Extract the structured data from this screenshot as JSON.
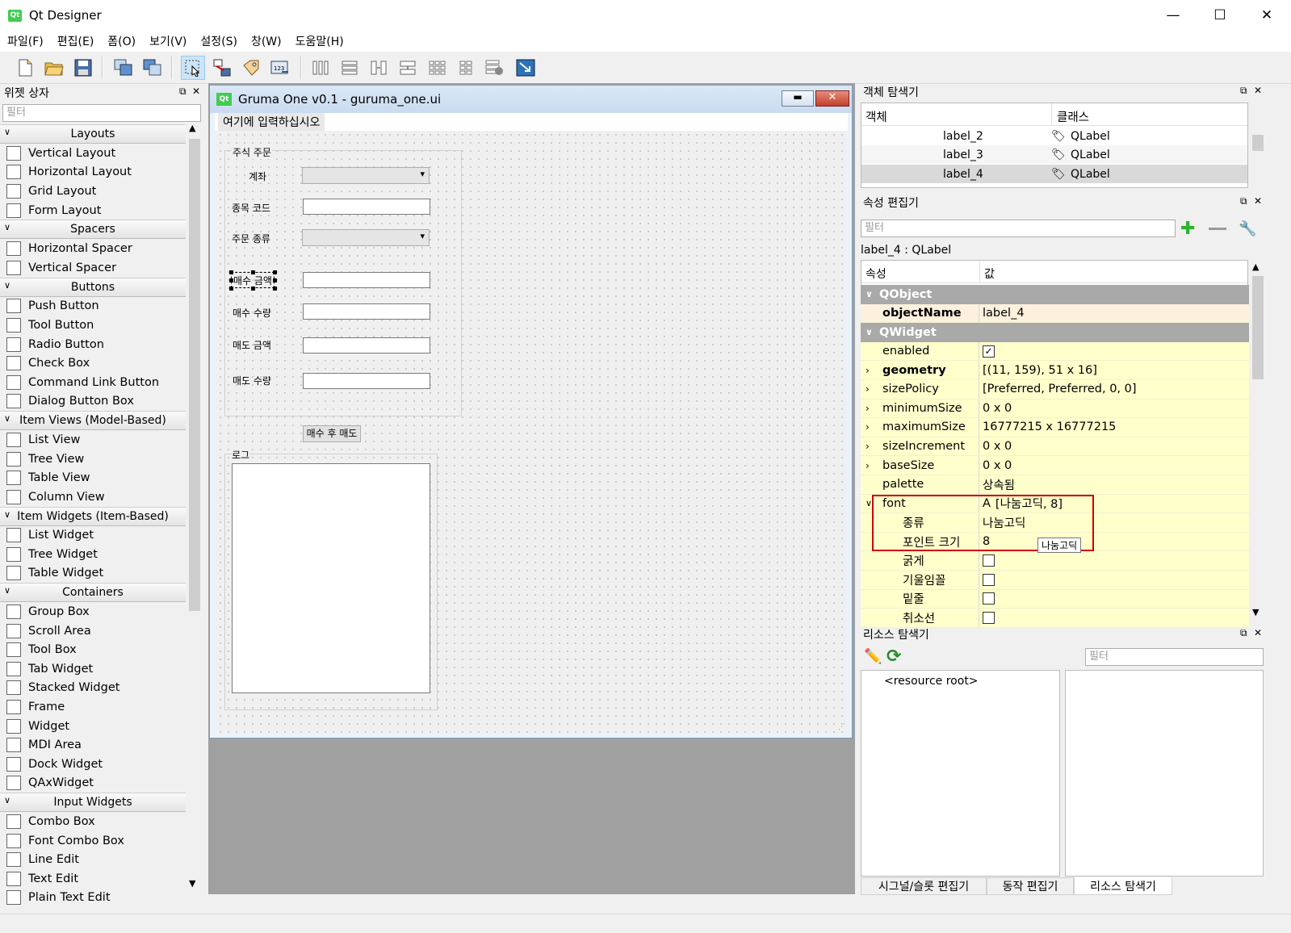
{
  "window": {
    "title": "Qt Designer",
    "minimize": "—",
    "maximize": "☐",
    "close": "✕"
  },
  "menu": [
    "파일(F)",
    "편집(E)",
    "폼(O)",
    "보기(V)",
    "설정(S)",
    "창(W)",
    "도움말(H)"
  ],
  "widget_box": {
    "title": "위젯 상자",
    "filter_placeholder": "필터",
    "categories": [
      {
        "label": "Layouts",
        "items": [
          "Vertical Layout",
          "Horizontal Layout",
          "Grid Layout",
          "Form Layout"
        ]
      },
      {
        "label": "Spacers",
        "items": [
          "Horizontal Spacer",
          "Vertical Spacer"
        ]
      },
      {
        "label": "Buttons",
        "items": [
          "Push Button",
          "Tool Button",
          "Radio Button",
          "Check Box",
          "Command Link Button",
          "Dialog Button Box"
        ]
      },
      {
        "label": "Item Views (Model-Based)",
        "items": [
          "List View",
          "Tree View",
          "Table View",
          "Column View"
        ]
      },
      {
        "label": "Item Widgets (Item-Based)",
        "items": [
          "List Widget",
          "Tree Widget",
          "Table Widget"
        ]
      },
      {
        "label": "Containers",
        "items": [
          "Group Box",
          "Scroll Area",
          "Tool Box",
          "Tab Widget",
          "Stacked Widget",
          "Frame",
          "Widget",
          "MDI Area",
          "Dock Widget",
          "QAxWidget"
        ]
      },
      {
        "label": "Input Widgets",
        "items": [
          "Combo Box",
          "Font Combo Box",
          "Line Edit",
          "Text Edit",
          "Plain Text Edit"
        ]
      }
    ]
  },
  "form": {
    "title": "Gruma One v0.1 - guruma_one.ui",
    "menu_placeholder": "여기에 입력하십시오",
    "group_title": "주식 주문",
    "labels": {
      "account": "계좌",
      "code": "종목 코드",
      "order_type": "주문 종류",
      "buy_amount": "매수 금액",
      "buy_qty": "매수 수량",
      "sell_amount": "매도 금액",
      "sell_qty": "매도 수량"
    },
    "button": "매수 후 매도",
    "log_title": "로그"
  },
  "object_inspector": {
    "title": "객체 탐색기",
    "col_object": "객체",
    "col_class": "클래스",
    "rows": [
      {
        "obj": "label_2",
        "cls": "QLabel"
      },
      {
        "obj": "label_3",
        "cls": "QLabel"
      },
      {
        "obj": "label_4",
        "cls": "QLabel"
      }
    ]
  },
  "property_editor": {
    "title": "속성 편집기",
    "filter_placeholder": "필터",
    "object_label": "label_4 : QLabel",
    "col_property": "속성",
    "col_value": "값",
    "rows": [
      {
        "kind": "group",
        "name": "QObject"
      },
      {
        "kind": "prop",
        "name": "objectName",
        "value": "label_4",
        "bold": true,
        "tint": "#fdf1dd"
      },
      {
        "kind": "group",
        "name": "QWidget"
      },
      {
        "kind": "prop",
        "name": "enabled",
        "check": true
      },
      {
        "kind": "prop",
        "name": "geometry",
        "value": "[(11, 159), 51 x 16]",
        "bold": true,
        "expand": true
      },
      {
        "kind": "prop",
        "name": "sizePolicy",
        "value": "[Preferred, Preferred, 0, 0]",
        "expand": true
      },
      {
        "kind": "prop",
        "name": "minimumSize",
        "value": "0 x 0",
        "expand": true
      },
      {
        "kind": "prop",
        "name": "maximumSize",
        "value": "16777215 x 16777215",
        "expand": true
      },
      {
        "kind": "prop",
        "name": "sizeIncrement",
        "value": "0 x 0",
        "expand": true
      },
      {
        "kind": "prop",
        "name": "baseSize",
        "value": "0 x 0",
        "expand": true
      },
      {
        "kind": "prop",
        "name": "palette",
        "value": "상속됨"
      },
      {
        "kind": "prop",
        "name": "font",
        "value": "[나눔고딕, 8]",
        "font_icon": "A",
        "open": true
      },
      {
        "kind": "sub",
        "name": "종류",
        "value": "나눔고딕"
      },
      {
        "kind": "sub",
        "name": "포인트 크기",
        "value": "8"
      },
      {
        "kind": "sub",
        "name": "굵게",
        "check": false
      },
      {
        "kind": "sub",
        "name": "기울임꼴",
        "check": false
      },
      {
        "kind": "sub",
        "name": "밑줄",
        "check": false
      },
      {
        "kind": "sub",
        "name": "취소선",
        "check": false
      }
    ],
    "tooltip": "나눔고딕"
  },
  "resource_browser": {
    "title": "리소스 탐색기",
    "filter_placeholder": "필터",
    "root": "<resource root>"
  },
  "bottom_tabs": [
    "시그널/슬롯 편집기",
    "동작 편집기",
    "리소스 탐색기"
  ],
  "colors": {
    "highlight": "#cc0000",
    "prop_bg": "#ffffcc",
    "group_bg": "#a9a9a9"
  }
}
